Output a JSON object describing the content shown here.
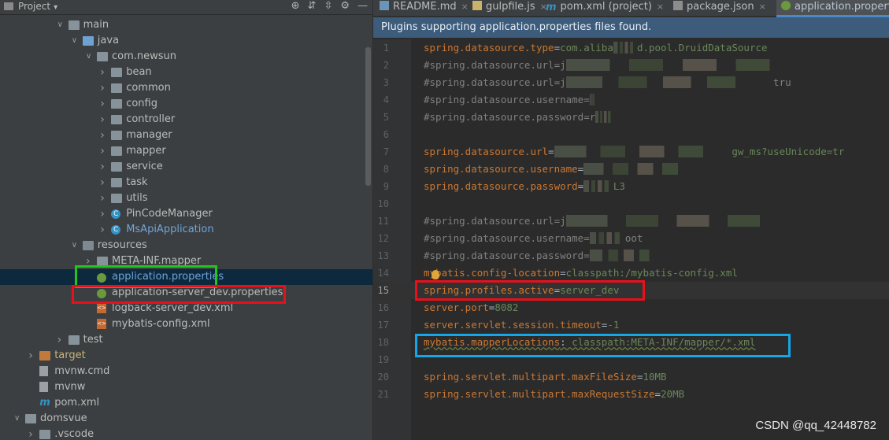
{
  "project_panel": {
    "title": "Project",
    "tree": [
      {
        "label": "main",
        "depth": 3,
        "expanded": true,
        "icon": "folder-icon"
      },
      {
        "label": "java",
        "depth": 4,
        "expanded": true,
        "icon": "source-folder-icon"
      },
      {
        "label": "com.newsun",
        "depth": 5,
        "expanded": true,
        "icon": "package-icon"
      },
      {
        "label": "bean",
        "depth": 6,
        "expanded": false,
        "icon": "package-icon"
      },
      {
        "label": "common",
        "depth": 6,
        "expanded": false,
        "icon": "package-icon"
      },
      {
        "label": "config",
        "depth": 6,
        "expanded": false,
        "icon": "package-icon"
      },
      {
        "label": "controller",
        "depth": 6,
        "expanded": false,
        "icon": "package-icon"
      },
      {
        "label": "manager",
        "depth": 6,
        "expanded": false,
        "icon": "package-icon"
      },
      {
        "label": "mapper",
        "depth": 6,
        "expanded": false,
        "icon": "package-icon"
      },
      {
        "label": "service",
        "depth": 6,
        "expanded": false,
        "icon": "package-icon"
      },
      {
        "label": "task",
        "depth": 6,
        "expanded": false,
        "icon": "package-icon"
      },
      {
        "label": "utils",
        "depth": 6,
        "expanded": false,
        "icon": "package-icon"
      },
      {
        "label": "PinCodeManager",
        "depth": 6,
        "expanded": false,
        "icon": "class-icon"
      },
      {
        "label": "MsApiApplication",
        "depth": 6,
        "expanded": false,
        "icon": "spring-boot-class-icon",
        "color": "blue"
      },
      {
        "label": "resources",
        "depth": 4,
        "expanded": true,
        "icon": "resources-folder-icon"
      },
      {
        "label": "META-INF.mapper",
        "depth": 5,
        "expanded": false,
        "icon": "folder-icon"
      },
      {
        "label": "application.properties",
        "depth": 5,
        "icon": "spring-properties-icon",
        "selected": true,
        "color": "blue"
      },
      {
        "label": "application-server_dev.properties",
        "depth": 5,
        "icon": "spring-properties-icon"
      },
      {
        "label": "logback-server_dev.xml",
        "depth": 5,
        "icon": "xml-icon"
      },
      {
        "label": "mybatis-config.xml",
        "depth": 5,
        "icon": "xml-icon"
      },
      {
        "label": "test",
        "depth": 3,
        "expanded": false,
        "icon": "folder-icon"
      },
      {
        "label": "target",
        "depth": 1,
        "expanded": false,
        "icon": "excluded-folder-icon",
        "color": "brown"
      },
      {
        "label": "mvnw.cmd",
        "depth": 1,
        "icon": "file-icon"
      },
      {
        "label": "mvnw",
        "depth": 1,
        "icon": "file-icon"
      },
      {
        "label": "pom.xml",
        "depth": 1,
        "icon": "maven-icon"
      },
      {
        "label": "domsvue",
        "depth": 0,
        "expanded": true,
        "icon": "folder-icon"
      },
      {
        "label": ".vscode",
        "depth": 1,
        "expanded": false,
        "icon": "folder-icon"
      }
    ]
  },
  "tabs": [
    {
      "label": "README.md",
      "icon": "markdown-icon"
    },
    {
      "label": "gulpfile.js",
      "icon": "js-icon"
    },
    {
      "label": "pom.xml (project)",
      "icon": "maven-icon"
    },
    {
      "label": "package.json",
      "icon": "json-icon"
    },
    {
      "label": "application.properties",
      "icon": "spring-properties-icon",
      "active": true
    }
  ],
  "banner": "Plugins supporting application.properties files found.",
  "code_lines": [
    {
      "n": "1",
      "key": "spring.datasource.type",
      "val": "com.aliba",
      "blur": "xxxx",
      "tail": "d.pool.DruidDataSource",
      "comment": false
    },
    {
      "n": "2",
      "key": "#spring.datasource.url",
      "val": "j",
      "blur": "xxxxxxxxxxxxxxxxxxxxxxxxxxxxxxxxxxxxxxxxx",
      "tail": "",
      "comment": true
    },
    {
      "n": "3",
      "key": "#spring.datasource.url",
      "val": "j",
      "blur": "xxxxxxxxxxxxxxxxxxxxxxxxxxxxxxxxxx",
      "tail": " tru",
      "comment": true
    },
    {
      "n": "4",
      "key": "#spring.datasource.username",
      "val": "",
      "blur": "x",
      "tail": "",
      "comment": true
    },
    {
      "n": "5",
      "key": "#spring.datasource.password",
      "val": "r",
      "blur": "xxx",
      "tail": "",
      "comment": true
    },
    {
      "n": "6",
      "key": "",
      "val": "",
      "blur": "",
      "tail": "",
      "comment": false
    },
    {
      "n": "7",
      "key": "spring.datasource.url",
      "val": "",
      "blur": "xxxxxxxxxxxxxxxxxxxxxxxxxxxxxx",
      "tail": "gw_ms?useUnicode=tr",
      "comment": false
    },
    {
      "n": "8",
      "key": "spring.datasource.username",
      "val": "",
      "blur": "xxxxxxxxxxxxxxxxxxx",
      "tail": "",
      "comment": false
    },
    {
      "n": "9",
      "key": "spring.datasource.password",
      "val": "",
      "blur": "xxxxx",
      "tail": "L3",
      "comment": false
    },
    {
      "n": "10",
      "key": "",
      "val": "",
      "blur": "",
      "tail": "",
      "comment": false
    },
    {
      "n": "11",
      "key": "#spring.datasource.url",
      "val": "j",
      "blur": "xxxxxxxxxxxxxxxxxxxxxxxxxxxxxxxxxxxxxxx",
      "tail": "",
      "comment": true
    },
    {
      "n": "12",
      "key": "#spring.datasource.username",
      "val": "",
      "blur": "xxxxxx",
      "tail": "oot",
      "comment": true
    },
    {
      "n": "13",
      "key": "#spring.datasource.password",
      "val": "",
      "blur": "xxxxxxxxxxxx",
      "tail": "",
      "comment": true
    },
    {
      "n": "14",
      "key": "mybatis.config-location",
      "val": "classpath:/mybatis-config.xml",
      "blur": "",
      "tail": "",
      "comment": false
    },
    {
      "n": "15",
      "key": "spring.profiles.active",
      "val": "server_dev",
      "blur": "",
      "tail": "",
      "comment": false,
      "current": true
    },
    {
      "n": "16",
      "key": "server.port",
      "val": "8082",
      "blur": "",
      "tail": "",
      "comment": false
    },
    {
      "n": "17",
      "key": "server.servlet.session.timeout",
      "val": "-1",
      "blur": "",
      "tail": "",
      "comment": false
    },
    {
      "n": "18",
      "key": "mybatis.mapperLocations",
      "val": " classpath:META-INF/mapper/*.xml",
      "blur": "",
      "tail": "",
      "comment": false,
      "sep": ":",
      "warn": true
    },
    {
      "n": "19",
      "key": "",
      "val": "",
      "blur": "",
      "tail": "",
      "comment": false
    },
    {
      "n": "20",
      "key": "spring.servlet.multipart.maxFileSize",
      "val": "10MB",
      "blur": "",
      "tail": "",
      "comment": false
    },
    {
      "n": "21",
      "key": "spring.servlet.multipart.maxRequestSize",
      "val": "20MB",
      "blur": "",
      "tail": "",
      "comment": false
    }
  ],
  "watermark": "CSDN @qq_42448782",
  "colors": {
    "highlight_green": "#22c41e",
    "highlight_red": "#e8101a",
    "highlight_cyan": "#14a6e6",
    "selection": "#0d293e",
    "banner": "#3d5b7a"
  }
}
